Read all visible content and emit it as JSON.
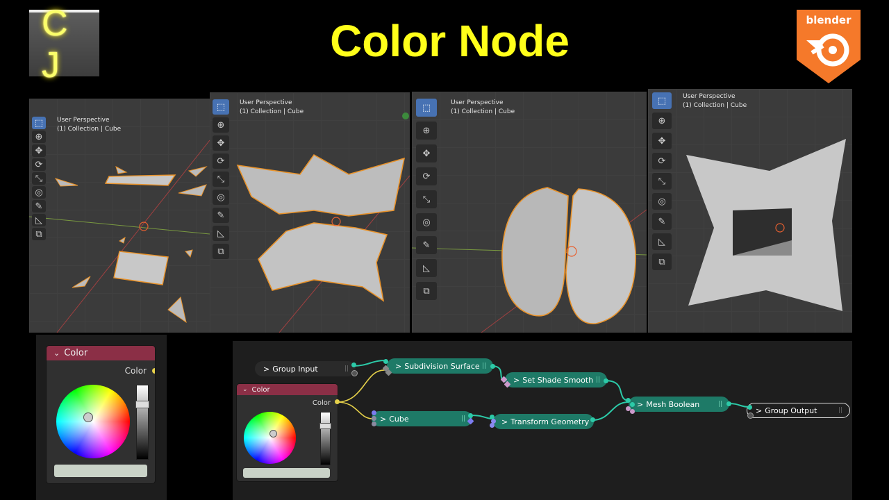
{
  "header": {
    "channel_logo_text": "C J",
    "title": "Color Node",
    "blender_logo_text": "blender",
    "colors": {
      "title": "#ffff1a",
      "blender_orange": "#f5792a"
    }
  },
  "viewports": [
    {
      "line1": "User Perspective",
      "line2": "(1) Collection | Cube"
    },
    {
      "line1": "User Perspective",
      "line2": "(1) Collection | Cube"
    },
    {
      "line1": "User Perspective",
      "line2": "(1) Collection | Cube"
    },
    {
      "line1": "User Perspective",
      "line2": "(1) Collection | Cube"
    }
  ],
  "toolbar_icons": [
    "select-box-icon",
    "cursor-icon",
    "move-icon",
    "rotate-icon",
    "scale-icon",
    "transform-icon",
    "annotate-icon",
    "measure-icon",
    "add-cube-icon"
  ],
  "color_node_large": {
    "header": "Color",
    "output_label": "Color"
  },
  "node_editor": {
    "group_input": "Group Input",
    "color_node": {
      "header": "Color",
      "output_label": "Color"
    },
    "subdivision_surface": "Subdivision Surface",
    "set_shade_smooth": "Set Shade Smooth",
    "mesh_boolean": "Mesh Boolean",
    "group_output": "Group Output",
    "cube": "Cube",
    "transform_geometry": "Transform Geometry",
    "chevron": ">",
    "grip": "||"
  }
}
